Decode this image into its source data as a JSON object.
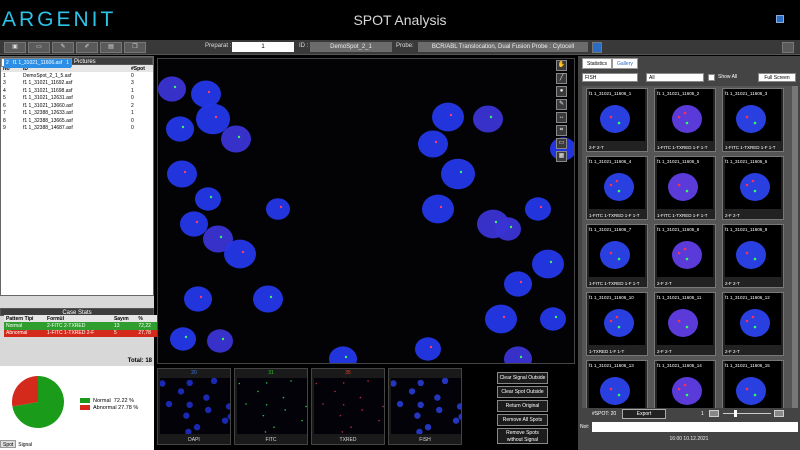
{
  "app": {
    "logo": "ARGENIT",
    "title": "SPOT Analysis"
  },
  "toolbar": {
    "preparat_label": "Preparat :",
    "preparat_value": "1",
    "id_label": "ID :",
    "id_value": "DemoSpot_2_1",
    "probe_label": "Probe:",
    "probe_value": "BCR/ABL Translocation, Dual Fusion Probe : Cytocell"
  },
  "case_pictures": {
    "title": "Case Pictures",
    "col_no": "No",
    "col_id": "ID",
    "col_spot": "#Spot",
    "rows": [
      {
        "no": "1",
        "id": "DemoSpot_2_1_5.asf",
        "spot": "0"
      },
      {
        "no": "2",
        "id": "f1 1_31021_11606.asf",
        "spot": "1"
      },
      {
        "no": "3",
        "id": "f1 1_31021_11692.asf",
        "spot": "3"
      },
      {
        "no": "4",
        "id": "f1 1_31021_11698.asf",
        "spot": "1"
      },
      {
        "no": "5",
        "id": "f1 1_31021_12631.asf",
        "spot": "0"
      },
      {
        "no": "6",
        "id": "f1 1_31021_13660.asf",
        "spot": "2"
      },
      {
        "no": "7",
        "id": "f1 1_32388_12633.asf",
        "spot": "1"
      },
      {
        "no": "8",
        "id": "f1 1_32388_13665.asf",
        "spot": "0"
      },
      {
        "no": "9",
        "id": "f1 1_32388_14687.asf",
        "spot": "0"
      }
    ]
  },
  "case_stats": {
    "title": "Case Stats",
    "col_pattern": "Pattern Tipi",
    "col_formul": "Formül",
    "col_sayim": "Sayım",
    "col_pct": "%",
    "rows": [
      {
        "pattern": "Normal",
        "formul": "2-FITC 2-TXRED",
        "sayim": "13",
        "pct": "72,22"
      },
      {
        "pattern": "Abnormal",
        "formul": "1-FITC 1-TXRED 2-F",
        "sayim": "5",
        "pct": "27,78"
      }
    ],
    "total": "Total: 18"
  },
  "pie": {
    "normal_label": "Normal",
    "normal_value": "72.22 %",
    "abnormal_label": "Abnormal",
    "abnormal_value": "27.78 %",
    "normal_color": "#1a9b1a",
    "abnormal_color": "#d42a1c",
    "normal_fraction": 0.7222
  },
  "bottom_tabs": {
    "spot": "Spot",
    "signal": "Signal"
  },
  "channels": [
    {
      "num": "20",
      "label": "DAPI",
      "num_color": "#3a7ce8"
    },
    {
      "num": "31",
      "label": "FITC",
      "num_color": "#2fc52f"
    },
    {
      "num": "35",
      "label": "TXRED",
      "num_color": "#e8452a"
    },
    {
      "num": "",
      "label": "FISH",
      "num_color": "#ffffff"
    }
  ],
  "actions": {
    "clear_signal": "Clear Signal Outside",
    "clear_spot": "Clear Spot Outside",
    "return_original": "Return Original",
    "remove_all": "Remove All Spots",
    "remove_without": "Remove Spots without Signal"
  },
  "right": {
    "tab_statistics": "Statistics",
    "tab_gallery": "Gallery",
    "filter1": "FISH",
    "filter2": "All",
    "show_all": "Show All",
    "full_screen": "Full Screen",
    "spot_count": "#SPOT: 20",
    "export": "Export",
    "page": "1",
    "note_label": "Not:",
    "datetime": "16:00 10.12.2021"
  },
  "gallery": [
    {
      "name": "f1 1_31021_11606_1",
      "sig": "2-F 2-T"
    },
    {
      "name": "f1 1_31021_11606_2",
      "sig": "1-FITC 1-TXRED 1-F 1-T"
    },
    {
      "name": "f1 1_31021_11606_3",
      "sig": "1-FITC 1-TXRED 1-F 1-T"
    },
    {
      "name": "f1 1_31021_11606_4",
      "sig": "1-FITC 1-TXRED 1-F 1-T"
    },
    {
      "name": "f1 1_31021_11606_5",
      "sig": "1-FITC 1-TXRED 1-F 1-T"
    },
    {
      "name": "f1 1_31021_11606_6",
      "sig": "2-F 2-T"
    },
    {
      "name": "f1 1_31021_11606_7",
      "sig": "1-FITC 1-TXRED 1-F 1-T"
    },
    {
      "name": "f1 1_31021_11606_8",
      "sig": "2-F 2-T"
    },
    {
      "name": "f1 1_31021_11606_9",
      "sig": "2-F 2-T"
    },
    {
      "name": "f1 1_31021_11606_10",
      "sig": "1-TXRED 1-F 1-T"
    },
    {
      "name": "f1 1_31021_11606_11",
      "sig": "2-F 2-T"
    },
    {
      "name": "f1 1_31021_11606_12",
      "sig": "2-F 2-T"
    },
    {
      "name": "f1 1_31021_11606_13",
      "sig": ""
    },
    {
      "name": "f1 1_31021_11606_14",
      "sig": ""
    },
    {
      "name": "f1 1_31021_11606_15",
      "sig": ""
    }
  ]
}
